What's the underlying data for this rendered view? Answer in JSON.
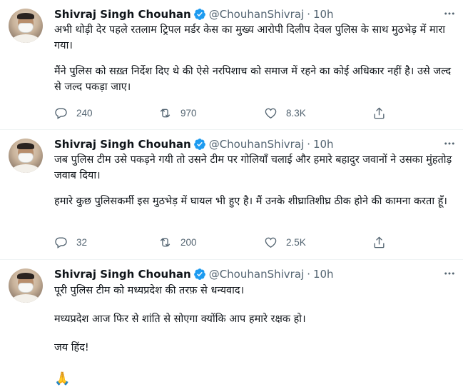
{
  "colors": {
    "text": "#0f1419",
    "muted": "#536471",
    "verified": "#1d9bf0",
    "divider": "#eff3f4"
  },
  "tweets": [
    {
      "name": "Shivraj Singh Chouhan",
      "handle": "@ChouhanShivraj",
      "dot": "·",
      "time": "10h",
      "paragraphs": [
        "अभी थोड़ी देर पहले रतलाम ट्रिपल मर्डर केस का मुख्य आरोपी दिलीप देवल पुलिस के साथ मुठभेड़ में मारा गया।",
        "मैंने पुलिस को सख़्त निर्देश दिए थे की ऐसे नरपिशाच को समाज में रहने का कोई अधिकार नहीं है। उसे जल्द से जल्द पकड़ा जाए।"
      ],
      "replies": "240",
      "retweets": "970",
      "likes": "8.3K"
    },
    {
      "name": "Shivraj Singh Chouhan",
      "handle": "@ChouhanShivraj",
      "dot": "·",
      "time": "10h",
      "paragraphs": [
        "जब पुलिस टीम उसे पकड़ने गयी तो उसने टीम पर गोलियाँ चलाई और हमारे बहादुर जवानों ने उसका मुंहतोड़ जवाब दिया।",
        "हमारे कुछ पुलिसकर्मी इस मुठभेड़ में घायल भी हुए है। मैं उनके शीघ्रातिशीघ्र ठीक होने की कामना करता हूँ।"
      ],
      "replies": "32",
      "retweets": "200",
      "likes": "2.5K"
    },
    {
      "name": "Shivraj Singh Chouhan",
      "handle": "@ChouhanShivraj",
      "dot": "·",
      "time": "10h",
      "paragraphs": [
        "पूरी पुलिस टीम को मध्यप्रदेश की तरफ़ से धन्यवाद।",
        "मध्यप्रदेश आज फिर से शांति से सोएगा क्योंकि आप हमारे रक्षक हो।",
        "जय हिंद!"
      ],
      "emoji": "🙏"
    }
  ]
}
